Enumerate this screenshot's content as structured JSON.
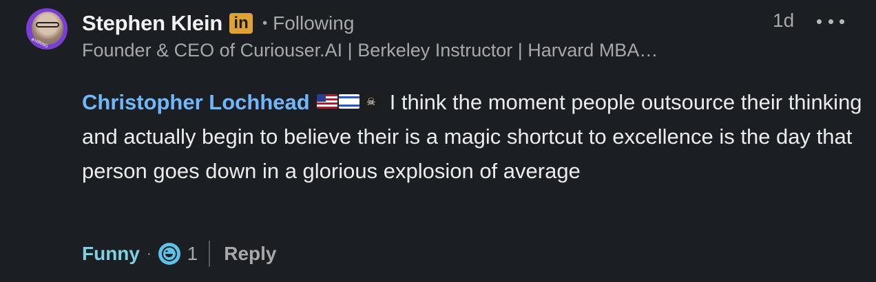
{
  "author": {
    "name": "Stephen Klein",
    "badge": "in",
    "separator": "•",
    "following": "Following",
    "headline": "Founder & CEO of Curiouser.AI | Berkeley Instructor | Harvard MBA…",
    "avatar_ring_text": "#HIRING"
  },
  "meta": {
    "timestamp": "1d",
    "more_icon": "ellipsis-icon"
  },
  "comment": {
    "mention": "Christopher Lochhead",
    "flags": [
      "us-flag",
      "israel-flag",
      "pirate-flag"
    ],
    "text": "I think the moment people outsource their thinking and actually begin to believe their is a magic shortcut to excellence is the day that person goes down in a glorious explosion of average"
  },
  "actions": {
    "reaction_label": "Funny",
    "separator": "·",
    "reaction_icon": "laugh-icon",
    "reaction_count": "1",
    "reply_label": "Reply"
  },
  "colors": {
    "background": "#1b1f23",
    "mention": "#71b7fb",
    "reaction": "#7fd1e0",
    "linkedin_badge": "#e0a233",
    "muted": "#a8a8a8"
  }
}
